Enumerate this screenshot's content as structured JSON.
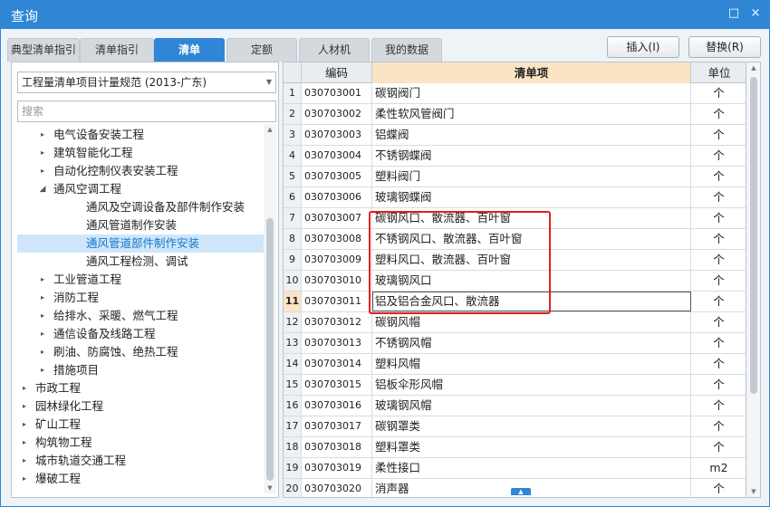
{
  "window": {
    "title": "查询",
    "minimize_label": "□",
    "close_label": "×"
  },
  "tabs": [
    {
      "label": "典型清单指引"
    },
    {
      "label": "清单指引"
    },
    {
      "label": "清单"
    },
    {
      "label": "定额"
    },
    {
      "label": "人材机"
    },
    {
      "label": "我的数据"
    }
  ],
  "active_tab": "清单",
  "buttons": {
    "insert_label": "插入(I)",
    "replace_label": "替换(R)"
  },
  "left": {
    "spec_combo_value": "工程量清单项目计量规范 (2013-广东)",
    "search_placeholder": "搜索",
    "tree": [
      {
        "label": "电气设备安装工程",
        "level": 2,
        "toggle": "▸"
      },
      {
        "label": "建筑智能化工程",
        "level": 2,
        "toggle": "▸"
      },
      {
        "label": "自动化控制仪表安装工程",
        "level": 2,
        "toggle": "▸"
      },
      {
        "label": "通风空调工程",
        "level": 2,
        "toggle": "◢"
      },
      {
        "label": "通风及空调设备及部件制作安装",
        "level": 3,
        "toggle": ""
      },
      {
        "label": "通风管道制作安装",
        "level": 3,
        "toggle": ""
      },
      {
        "label": "通风管道部件制作安装",
        "level": 3,
        "toggle": "",
        "selected": true
      },
      {
        "label": "通风工程检测、调试",
        "level": 3,
        "toggle": ""
      },
      {
        "label": "工业管道工程",
        "level": 2,
        "toggle": "▸"
      },
      {
        "label": "消防工程",
        "level": 2,
        "toggle": "▸"
      },
      {
        "label": "给排水、采暖、燃气工程",
        "level": 2,
        "toggle": "▸"
      },
      {
        "label": "通信设备及线路工程",
        "level": 2,
        "toggle": "▸"
      },
      {
        "label": "刷油、防腐蚀、绝热工程",
        "level": 2,
        "toggle": "▸"
      },
      {
        "label": "措施项目",
        "level": 2,
        "toggle": "▸"
      },
      {
        "label": "市政工程",
        "level": 1,
        "toggle": "▸"
      },
      {
        "label": "园林绿化工程",
        "level": 1,
        "toggle": "▸"
      },
      {
        "label": "矿山工程",
        "level": 1,
        "toggle": "▸"
      },
      {
        "label": "构筑物工程",
        "level": 1,
        "toggle": "▸"
      },
      {
        "label": "城市轨道交通工程",
        "level": 1,
        "toggle": "▸"
      },
      {
        "label": "爆破工程",
        "level": 1,
        "toggle": "▸"
      }
    ]
  },
  "grid": {
    "columns": {
      "code": "编码",
      "item": "清单项",
      "unit": "单位"
    },
    "active_row": 11,
    "rows": [
      {
        "num": "1",
        "code": "030703001",
        "item": "碳钢阀门",
        "unit": "个"
      },
      {
        "num": "2",
        "code": "030703002",
        "item": "柔性软风管阀门",
        "unit": "个"
      },
      {
        "num": "3",
        "code": "030703003",
        "item": "铝蝶阀",
        "unit": "个"
      },
      {
        "num": "4",
        "code": "030703004",
        "item": "不锈钢蝶阀",
        "unit": "个"
      },
      {
        "num": "5",
        "code": "030703005",
        "item": "塑料阀门",
        "unit": "个"
      },
      {
        "num": "6",
        "code": "030703006",
        "item": "玻璃钢蝶阀",
        "unit": "个"
      },
      {
        "num": "7",
        "code": "030703007",
        "item": "碳钢风口、散流器、百叶窗",
        "unit": "个"
      },
      {
        "num": "8",
        "code": "030703008",
        "item": "不锈钢风口、散流器、百叶窗",
        "unit": "个"
      },
      {
        "num": "9",
        "code": "030703009",
        "item": "塑料风口、散流器、百叶窗",
        "unit": "个"
      },
      {
        "num": "10",
        "code": "030703010",
        "item": "玻璃钢风口",
        "unit": "个"
      },
      {
        "num": "11",
        "code": "030703011",
        "item": "铝及铝合金风口、散流器",
        "unit": "个"
      },
      {
        "num": "12",
        "code": "030703012",
        "item": "碳钢风帽",
        "unit": "个"
      },
      {
        "num": "13",
        "code": "030703013",
        "item": "不锈钢风帽",
        "unit": "个"
      },
      {
        "num": "14",
        "code": "030703014",
        "item": "塑料风帽",
        "unit": "个"
      },
      {
        "num": "15",
        "code": "030703015",
        "item": "铝板伞形风帽",
        "unit": "个"
      },
      {
        "num": "16",
        "code": "030703016",
        "item": "玻璃钢风帽",
        "unit": "个"
      },
      {
        "num": "17",
        "code": "030703017",
        "item": "碳钢罩类",
        "unit": "个"
      },
      {
        "num": "18",
        "code": "030703018",
        "item": "塑料罩类",
        "unit": "个"
      },
      {
        "num": "19",
        "code": "030703019",
        "item": "柔性接口",
        "unit": "m2"
      },
      {
        "num": "20",
        "code": "030703020",
        "item": "消声器",
        "unit": "个"
      }
    ]
  },
  "colors": {
    "accent": "#2f86d5",
    "header_highlight": "#fbe4c3",
    "annotation": "#e02020"
  }
}
